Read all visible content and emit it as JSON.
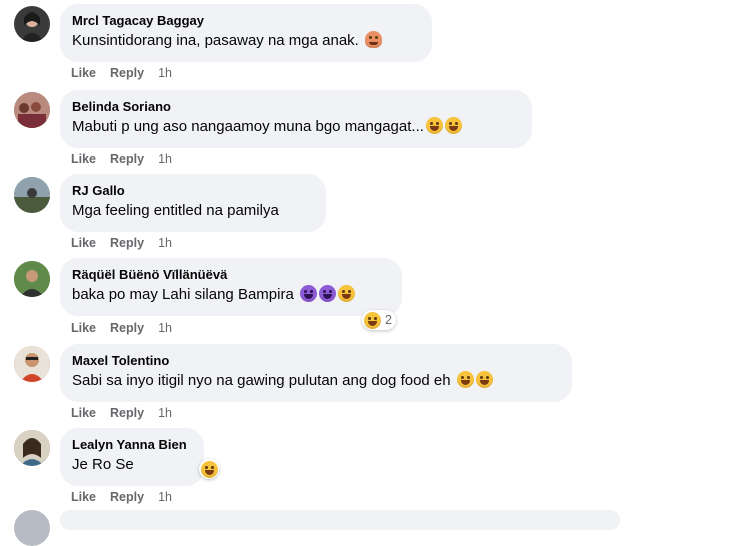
{
  "comments": [
    {
      "author": "Mrcl Tagacay Baggay",
      "text": "Kunsintidorang ina, pasaway na mga anak.",
      "emojis": [
        "person-gesturing-icon"
      ],
      "like": "Like",
      "reply": "Reply",
      "time": "1h",
      "avatar_color": "#3a3a3a"
    },
    {
      "author": "Belinda Soriano",
      "text": "Mabuti p ung aso nangaamoy muna bgo mangagat...",
      "emojis": [
        "grinning-face-icon",
        "grinning-face-icon"
      ],
      "like": "Like",
      "reply": "Reply",
      "time": "1h",
      "avatar_color": "#a8746a"
    },
    {
      "author": "RJ Gallo",
      "text": "Mga feeling entitled na pamilya",
      "emojis": [],
      "like": "Like",
      "reply": "Reply",
      "time": "1h",
      "avatar_color": "#6f7d86"
    },
    {
      "author": "Räqüël Büënö Vïllänüëvä",
      "text": "baka po may Lahi silang Bampira",
      "emojis": [
        "smiling-devil-icon",
        "smiling-devil-icon",
        "tears-of-joy-icon"
      ],
      "like": "Like",
      "reply": "Reply",
      "time": "1h",
      "reaction_count": "2",
      "avatar_color": "#4f7a3d"
    },
    {
      "author": "Maxel Tolentino",
      "text": "Sabi sa inyo itigil nyo na gawing pulutan ang dog food eh",
      "emojis": [
        "grinning-face-icon",
        "grinning-face-icon"
      ],
      "like": "Like",
      "reply": "Reply",
      "time": "1h",
      "avatar_color": "#c96a4a"
    },
    {
      "author": "Lealyn Yanna Bien",
      "text": "Je Ro Se",
      "emojis": [],
      "like": "Like",
      "reply": "Reply",
      "time": "1h",
      "avatar_color": "#8c6b4f"
    }
  ],
  "colors": {
    "bubble": "#f0f2f5",
    "text": "#050505",
    "secondary": "#65676b"
  }
}
